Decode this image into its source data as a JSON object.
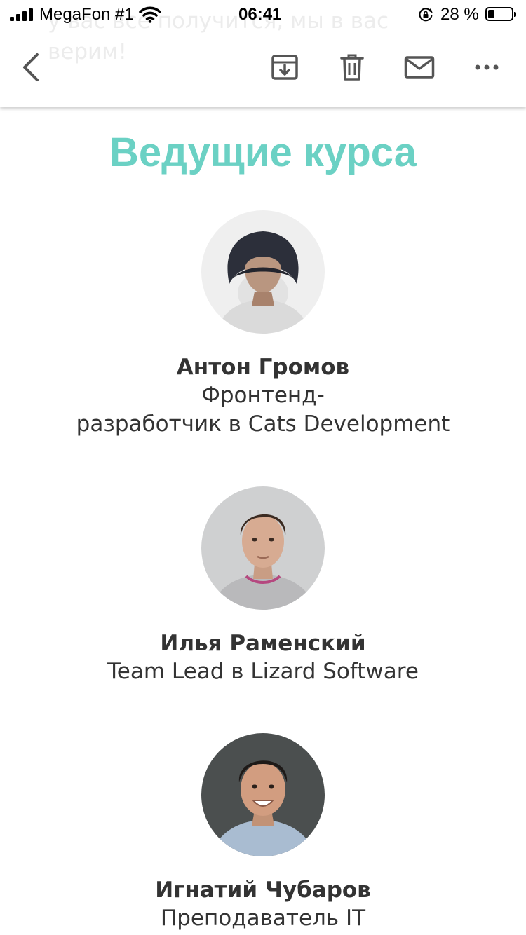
{
  "status_bar": {
    "carrier": "MegaFon #1",
    "time": "06:41",
    "battery_percent": "28 %",
    "battery_level": 0.28
  },
  "header": {
    "ghost_text_lines": [
      "у вас всё получится, мы в вас",
      "верим!"
    ]
  },
  "toolbar": {
    "icons": [
      "back-chevron-icon",
      "archive-icon",
      "trash-icon",
      "mail-icon",
      "more-icon"
    ]
  },
  "section": {
    "title": "Ведущие курса"
  },
  "people": [
    {
      "name": "Антон Громов",
      "role_lines": [
        "Фронтенд-",
        "разработчик в Cats Development"
      ]
    },
    {
      "name": "Илья Раменский",
      "role_lines": [
        "Team Lead в Lizard Software"
      ]
    },
    {
      "name": "Игнатий Чубаров",
      "role_lines": [
        "Преподаватель IT"
      ]
    }
  ],
  "colors": {
    "accent": "#6bd1c4",
    "text": "#333333"
  }
}
